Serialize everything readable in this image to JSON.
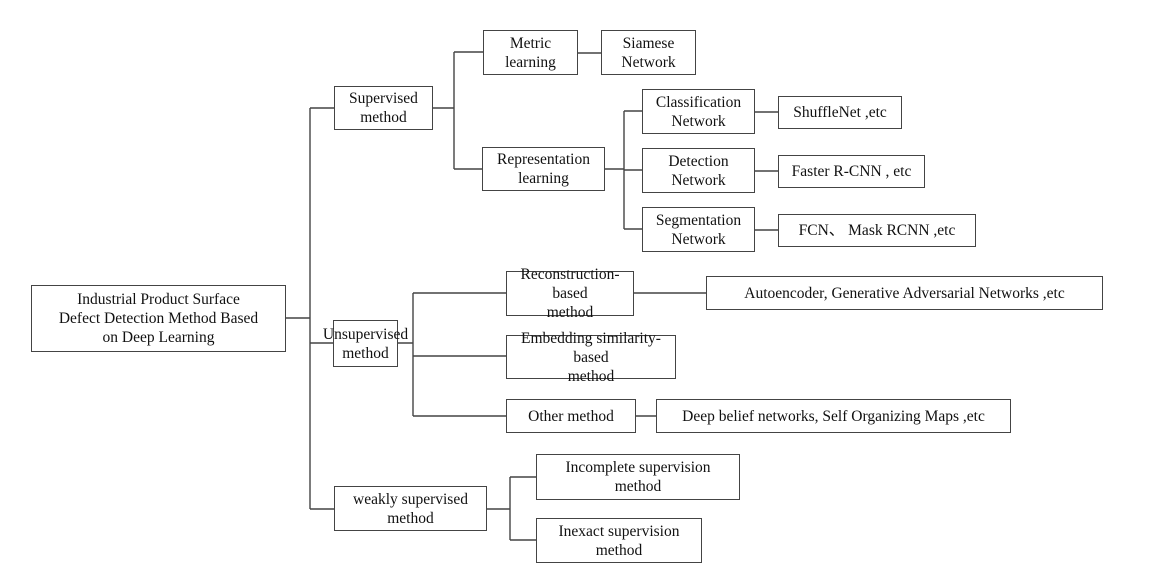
{
  "diagram": {
    "type": "tree",
    "root": "Industrial Product Surface\nDefect Detection Method Based\non Deep Learning",
    "nodes": {
      "supervised": "Supervised\nmethod",
      "metric": "Metric\nlearning",
      "siamese": "Siamese\nNetwork",
      "representation": "Representation\nlearning",
      "classification": "Classification\nNetwork",
      "shufflenet": "ShuffleNet ,etc",
      "detection": "Detection\nNetwork",
      "faster": "Faster R-CNN , etc",
      "segmentation": "Segmentation\nNetwork",
      "fcn": "FCN、 Mask RCNN ,etc",
      "unsupervised": "Unsupervised\nmethod",
      "reconstruction": "Reconstruction-based\nmethod",
      "autoencoder": "Autoencoder, Generative Adversarial Networks ,etc",
      "embedding": "Embedding similarity-based\nmethod",
      "other": "Other method",
      "deepbelief": "Deep belief networks, Self Organizing Maps ,etc",
      "weakly": "weakly supervised\nmethod",
      "incomplete": "Incomplete supervision\nmethod",
      "inexact": "Inexact supervision\nmethod"
    },
    "edges": [
      [
        "root",
        "supervised"
      ],
      [
        "root",
        "unsupervised"
      ],
      [
        "root",
        "weakly"
      ],
      [
        "supervised",
        "metric"
      ],
      [
        "supervised",
        "representation"
      ],
      [
        "metric",
        "siamese"
      ],
      [
        "representation",
        "classification"
      ],
      [
        "representation",
        "detection"
      ],
      [
        "representation",
        "segmentation"
      ],
      [
        "classification",
        "shufflenet"
      ],
      [
        "detection",
        "faster"
      ],
      [
        "segmentation",
        "fcn"
      ],
      [
        "unsupervised",
        "reconstruction"
      ],
      [
        "unsupervised",
        "embedding"
      ],
      [
        "unsupervised",
        "other"
      ],
      [
        "reconstruction",
        "autoencoder"
      ],
      [
        "other",
        "deepbelief"
      ],
      [
        "weakly",
        "incomplete"
      ],
      [
        "weakly",
        "inexact"
      ]
    ]
  }
}
